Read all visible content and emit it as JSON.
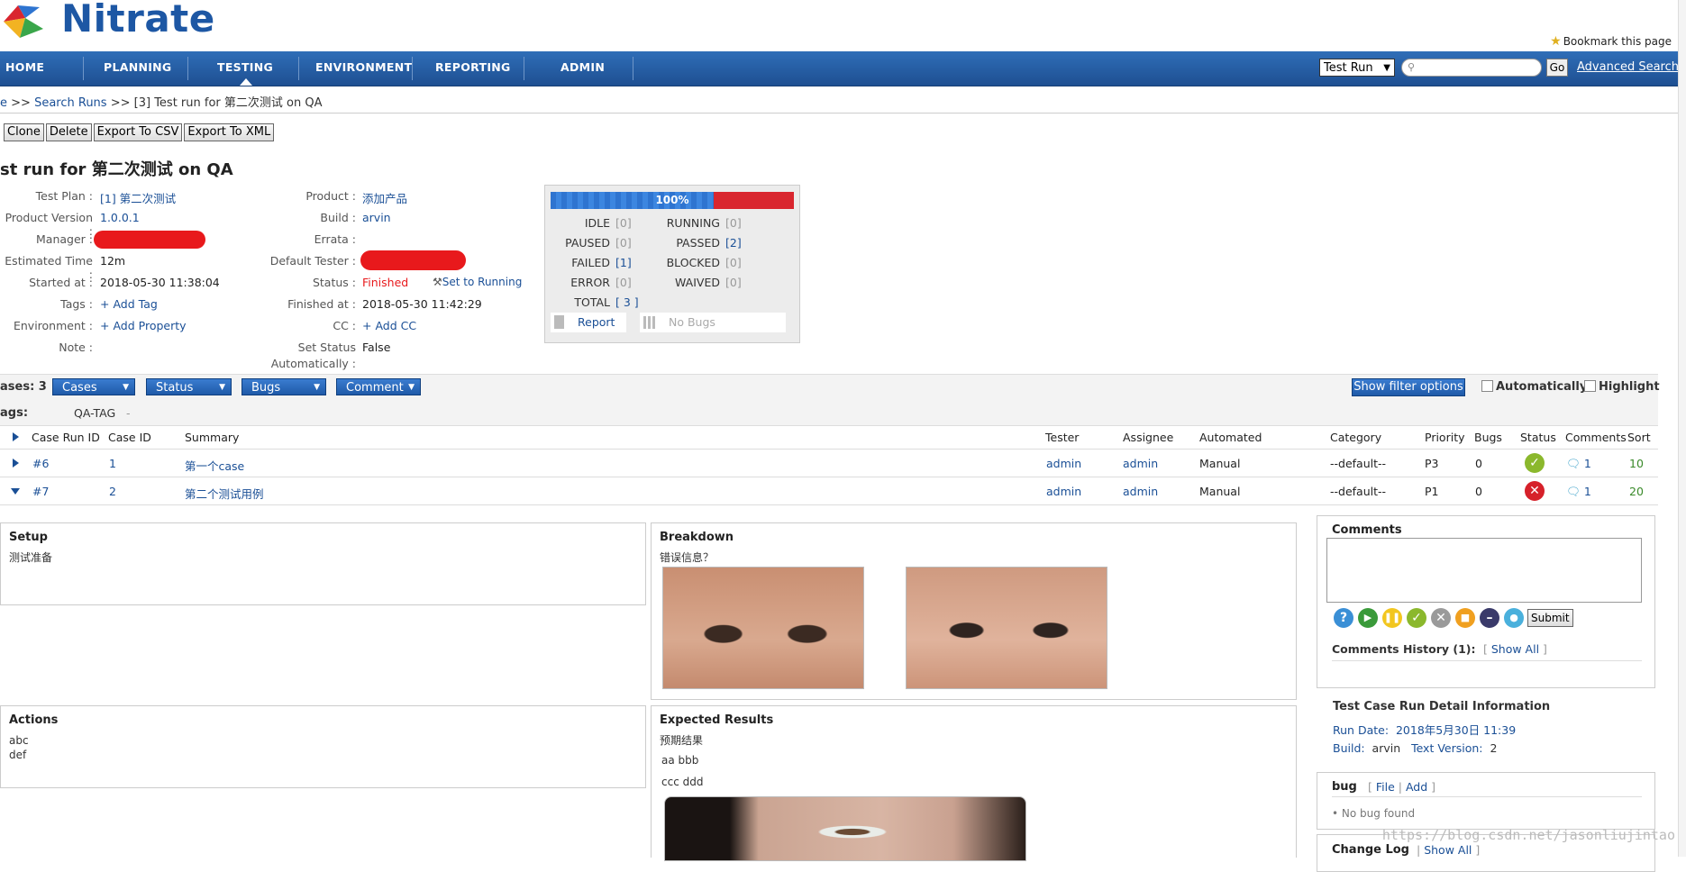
{
  "header": {
    "app_name": "Nitrate",
    "bookmark_label": "Bookmark this page"
  },
  "nav": {
    "items": [
      "HOME",
      "PLANNING",
      "TESTING",
      "ENVIRONMENT",
      "REPORTING",
      "ADMIN"
    ],
    "active": "TESTING",
    "search_type": "Test Run",
    "search_value": "",
    "go_label": "Go",
    "advanced_search": "Advanced Search"
  },
  "breadcrumb": {
    "home": "e",
    "sep1": ">>",
    "search_runs": "Search Runs",
    "sep2": ">>",
    "current": "[3] Test run for 第二次测试 on QA"
  },
  "toolbar": {
    "clone": "Clone",
    "delete": "Delete",
    "export_csv": "Export To CSV",
    "export_xml": "Export To XML"
  },
  "run": {
    "title": "st run for 第二次测试 on QA",
    "left": [
      {
        "label": "Test Plan :",
        "value": "[1] 第二次测试",
        "link": true
      },
      {
        "label": "Product Version :",
        "value": "1.0.0.1",
        "link": true
      },
      {
        "label": "Manager :",
        "value": "",
        "link": false
      },
      {
        "label": "Estimated Time :",
        "value": "12m",
        "link": false
      },
      {
        "label": "Started at :",
        "value": "2018-05-30 11:38:04",
        "link": false
      },
      {
        "label": "Tags :",
        "value": "Add Tag",
        "link": true
      },
      {
        "label": "Environment :",
        "value": "Add Property",
        "link": true
      },
      {
        "label": "Note :",
        "value": "",
        "link": false
      }
    ],
    "right": [
      {
        "label": "Product :",
        "value": "添加产品",
        "link": true
      },
      {
        "label": "Build :",
        "value": "arvin",
        "link": true
      },
      {
        "label": "Errata :",
        "value": "",
        "link": false
      },
      {
        "label": "Default Tester :",
        "value": "",
        "link": false
      },
      {
        "label": "Status :",
        "value": "Finished",
        "link": false
      },
      {
        "label": "Finished at :",
        "value": "2018-05-30 11:42:29",
        "link": false
      },
      {
        "label": "CC :",
        "value": "Add CC",
        "link": true
      },
      {
        "label": "Set Status",
        "value": "False",
        "link": false
      }
    ],
    "set_status_label2": "Automatically :",
    "set_to_running": "Set to Running"
  },
  "progress": {
    "percent_label": "100%",
    "pass_fraction": 0.67,
    "stats": [
      {
        "label": "IDLE",
        "value": "0"
      },
      {
        "label": "RUNNING",
        "value": "0"
      },
      {
        "label": "PAUSED",
        "value": "0"
      },
      {
        "label": "PASSED",
        "value": "2"
      },
      {
        "label": "FAILED",
        "value": "1"
      },
      {
        "label": "BLOCKED",
        "value": "0"
      },
      {
        "label": "ERROR",
        "value": "0"
      },
      {
        "label": "WAIVED",
        "value": "0"
      }
    ],
    "total_label": "TOTAL",
    "total_value": "3",
    "report_label": "Report",
    "no_bugs_label": "No Bugs"
  },
  "cases_bar": {
    "count_label": "ases: 3",
    "dropdowns": [
      "Cases",
      "Status",
      "Bugs",
      "Comment"
    ],
    "filter_button": "Show filter options",
    "automatically": "Automatically",
    "highlight": "Highlight"
  },
  "tags_bar": {
    "label": "ags:",
    "tag": "QA-TAG",
    "remove": "-"
  },
  "table": {
    "columns": [
      "Case Run ID",
      "Case ID",
      "Summary",
      "Tester",
      "Assignee",
      "Automated",
      "Category",
      "Priority",
      "Bugs",
      "Status",
      "Comments",
      "Sort"
    ],
    "rows": [
      {
        "run_id": "#6",
        "case_id": "1",
        "summary": "第一个case",
        "tester": "admin",
        "assignee": "admin",
        "automated": "Manual",
        "category": "--default--",
        "priority": "P3",
        "bugs": "0",
        "status": "passed",
        "comments": "1",
        "sort": "10",
        "expanded": false
      },
      {
        "run_id": "#7",
        "case_id": "2",
        "summary": "第二个测试用例",
        "tester": "admin",
        "assignee": "admin",
        "automated": "Manual",
        "category": "--default--",
        "priority": "P1",
        "bugs": "0",
        "status": "failed",
        "comments": "1",
        "sort": "20",
        "expanded": true
      }
    ]
  },
  "detail": {
    "setup_title": "Setup",
    "setup_body": "测试准备",
    "breakdown_title": "Breakdown",
    "breakdown_body": "错误信息？",
    "actions_title": "Actions",
    "actions_line1": "abc",
    "actions_line2": "def",
    "expected_title": "Expected Results",
    "expected_line1": "预期结果",
    "expected_line2": "aa bbb",
    "expected_line3": "ccc ddd",
    "comments_title": "Comments",
    "submit_label": "Submit",
    "history_label": "Comments History (1):",
    "show_all": "Show All",
    "run_detail_title": "Test Case Run Detail Information",
    "run_date_label": "Run Date:",
    "run_date_value": "2018年5月30日 11:39",
    "build_label": "Build:",
    "build_value": "arvin",
    "text_version_label": "Text Version:",
    "text_version_value": "2",
    "bug_title": "bug",
    "bug_file": "File",
    "bug_add": "Add",
    "no_bug": "No bug found",
    "changelog_title": "Change Log",
    "changelog_show_all": "Show All"
  },
  "watermark": "https://blog.csdn.net/jasonliujintao",
  "colors": {
    "nav": "#1e4f92",
    "link": "#1a4f96",
    "status_finished": "#e8191c",
    "passed": "#8bb82d",
    "failed": "#d6212a"
  }
}
